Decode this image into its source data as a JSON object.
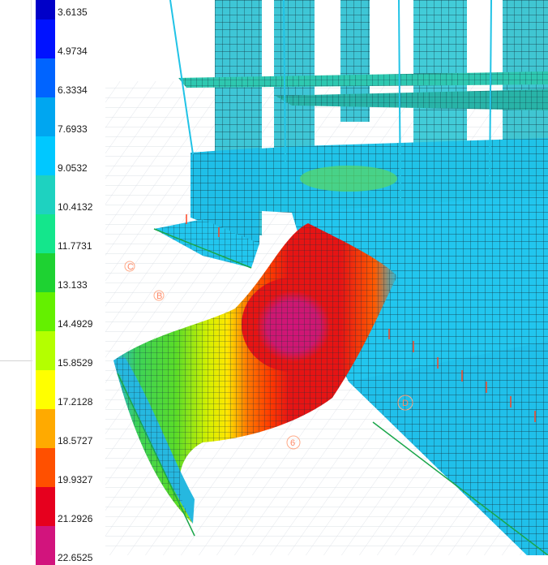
{
  "legend": {
    "items": [
      {
        "value": "3.6135",
        "color": "#0000c8"
      },
      {
        "value": "4.9734",
        "color": "#0012ff"
      },
      {
        "value": "6.3334",
        "color": "#0064ff"
      },
      {
        "value": "7.6933",
        "color": "#00a6f0"
      },
      {
        "value": "9.0532",
        "color": "#00c8ff"
      },
      {
        "value": "10.4132",
        "color": "#1ed2c0"
      },
      {
        "value": "11.7731",
        "color": "#14e68c"
      },
      {
        "value": "13.133",
        "color": "#1ed232"
      },
      {
        "value": "14.4929",
        "color": "#64f000"
      },
      {
        "value": "15.8529",
        "color": "#b4ff00"
      },
      {
        "value": "17.2128",
        "color": "#ffff00"
      },
      {
        "value": "18.5727",
        "color": "#ffaa00"
      },
      {
        "value": "19.9327",
        "color": "#ff5000"
      },
      {
        "value": "21.2926",
        "color": "#e6001e"
      },
      {
        "value": "22.6525",
        "color": "#d2147d"
      }
    ]
  },
  "viewport": {
    "grid_labels": [
      "6",
      "C",
      "B",
      "D"
    ],
    "colors": {
      "structure": "#21c3e6",
      "mesh_line": "#1a3a48",
      "slab_low": "#37c8d8",
      "peak": "#cc1e7a",
      "red": "#e61414",
      "orange": "#ff6a00",
      "yellow": "#ffff00",
      "green": "#3cd24a",
      "column": "#4ec8d0",
      "support": "#1aa64a",
      "load_arrow": "#ff4422"
    }
  }
}
